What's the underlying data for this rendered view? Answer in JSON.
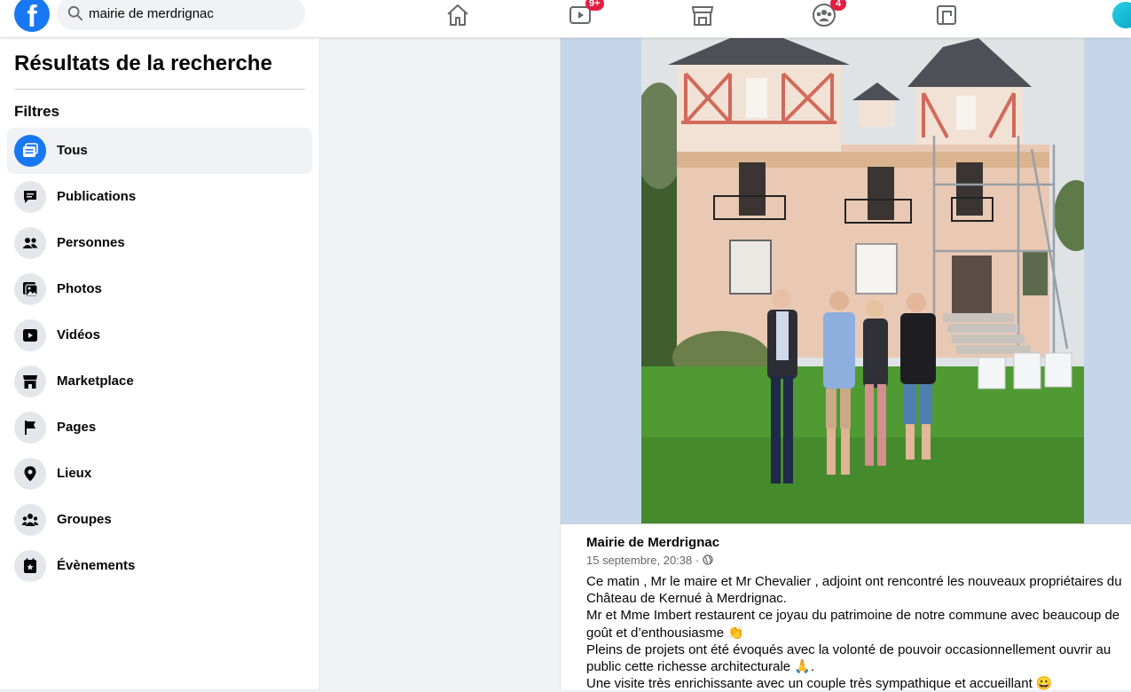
{
  "search": {
    "query": "mairie de merdrignac"
  },
  "nav": {
    "watch_badge": "9+",
    "groups_badge": "4"
  },
  "sidebar": {
    "title": "Résultats de la recherche",
    "filters_label": "Filtres",
    "items": [
      {
        "label": "Tous",
        "icon": "all-results-icon",
        "active": true
      },
      {
        "label": "Publications",
        "icon": "posts-icon"
      },
      {
        "label": "Personnes",
        "icon": "people-icon"
      },
      {
        "label": "Photos",
        "icon": "photos-icon"
      },
      {
        "label": "Vidéos",
        "icon": "video-icon"
      },
      {
        "label": "Marketplace",
        "icon": "marketplace-icon"
      },
      {
        "label": "Pages",
        "icon": "flag-icon"
      },
      {
        "label": "Lieux",
        "icon": "location-pin-icon"
      },
      {
        "label": "Groupes",
        "icon": "groups-icon"
      },
      {
        "label": "Évènements",
        "icon": "calendar-star-icon"
      }
    ]
  },
  "post": {
    "author": "Mairie de Merdrignac",
    "timestamp": "15 septembre, 20:38",
    "separator": "·",
    "lines": [
      "Ce matin  , Mr le maire et Mr Chevalier , adjoint ont rencontré les nouveaux propriétaires du Château de Kernué à Merdrignac.",
      "Mr et Mme Imbert restaurent ce joyau du patrimoine de notre commune avec beaucoup de goût et d’enthousiasme 👏",
      "Pleins de projets ont été évoqués avec la volonté de pouvoir occasionnellement ouvrir au public cette richesse architecturale 🙏.",
      "Une visite très enrichissante avec un couple très sympathique et accueillant 😀"
    ]
  },
  "colors": {
    "brand": "#1877f2",
    "badge": "#e41e3f",
    "background": "#f0f2f5"
  }
}
